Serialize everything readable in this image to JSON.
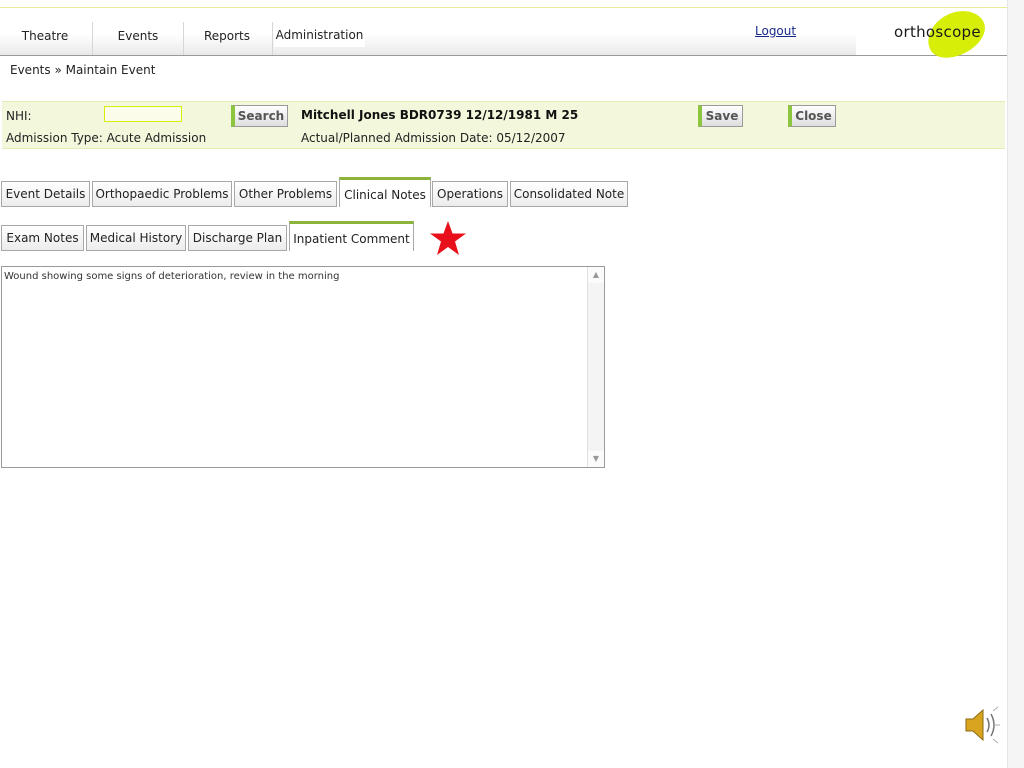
{
  "nav": {
    "items": [
      "Theatre",
      "Events",
      "Reports",
      "Administration"
    ],
    "logout": "Logout",
    "logo": "orthoscope"
  },
  "breadcrumb": "Events » Maintain Event",
  "patient_bar": {
    "nhi_label": "NHI:",
    "nhi_value": "",
    "search_label": "Search",
    "patient_title": "Mitchell Jones BDR0739 12/12/1981 M 25",
    "save_label": "Save",
    "close_label": "Close",
    "admission_type": "Admission Type: Acute Admission",
    "admission_date": "Actual/Planned Admission Date: 05/12/2007"
  },
  "main_tabs": [
    "Event Details",
    "Orthopaedic Problems",
    "Other Problems",
    "Clinical Notes",
    "Operations",
    "Consolidated Note"
  ],
  "main_tabs_active": "Clinical Notes",
  "sub_tabs": [
    "Exam Notes",
    "Medical History",
    "Discharge Plan",
    "Inpatient Comment"
  ],
  "sub_tabs_active": "Inpatient Comment",
  "note": {
    "text": "Wound showing some signs of deterioration, review in the morning"
  },
  "icons": {
    "marker": "red-star-icon",
    "audio": "speaker-icon"
  },
  "colors": {
    "accent_green": "#8cc63f",
    "logo_yellow": "#d6ee08",
    "bar_bg": "#f3f8dc",
    "star_red": "#e8101a"
  }
}
